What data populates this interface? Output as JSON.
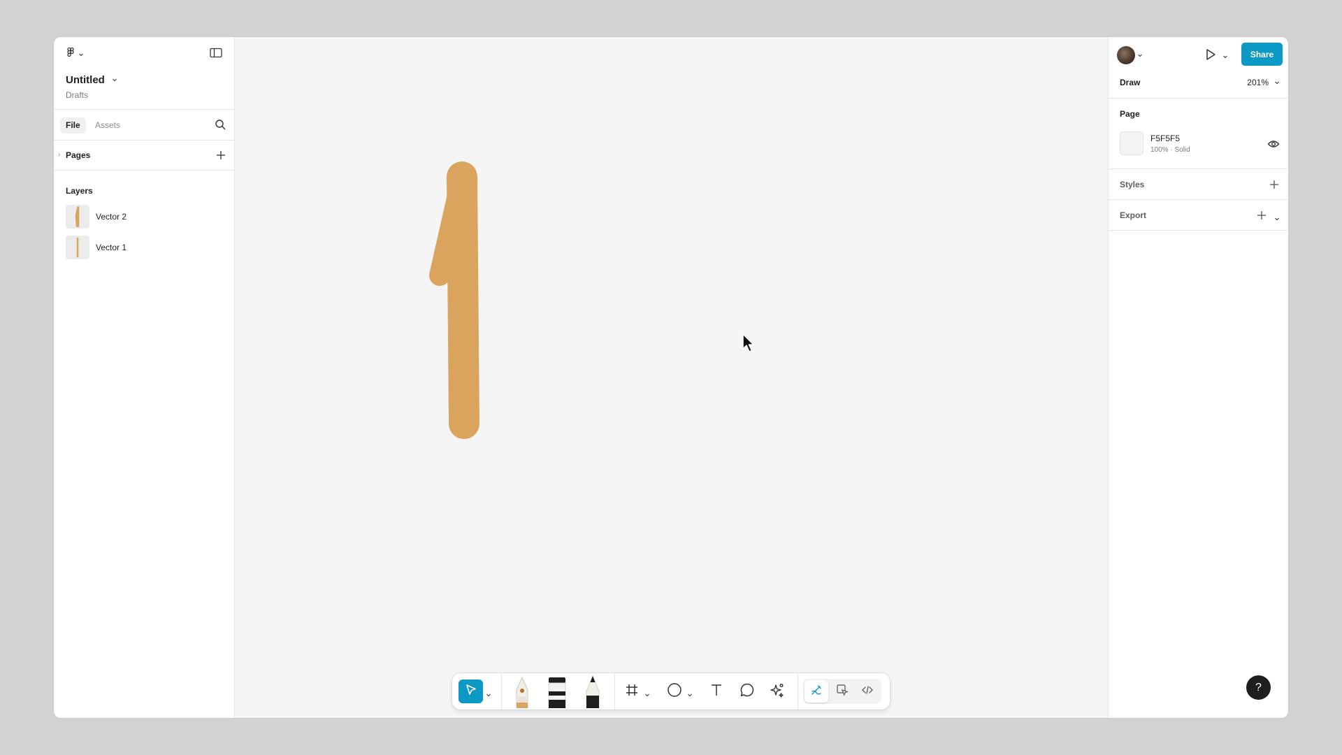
{
  "header": {
    "file_title": "Untitled",
    "location": "Drafts"
  },
  "left_panel": {
    "tabs": [
      {
        "label": "File",
        "active": true
      },
      {
        "label": "Assets",
        "active": false
      }
    ],
    "pages_label": "Pages",
    "layers_label": "Layers",
    "layers": [
      {
        "name": "Vector 2"
      },
      {
        "name": "Vector 1"
      }
    ]
  },
  "right_panel": {
    "share_label": "Share",
    "mode_label": "Draw",
    "zoom": "201%",
    "page_section_label": "Page",
    "page_color": {
      "hex": "F5F5F5",
      "meta": "100% · Solid"
    },
    "styles_label": "Styles",
    "export_label": "Export",
    "help_label": "?"
  },
  "colors": {
    "accent": "#0d99c5",
    "stroke": "#dba45e",
    "canvas": "#f5f5f5"
  },
  "toolbar": {
    "tools": [
      "move-tool",
      "pen-tool",
      "marker-tool",
      "pencil-tool",
      "frame-tool",
      "ellipse-tool",
      "text-tool",
      "comment-tool",
      "actions-tool",
      "draw-mode",
      "design-mode",
      "dev-mode"
    ],
    "active_tool": "move-tool"
  }
}
